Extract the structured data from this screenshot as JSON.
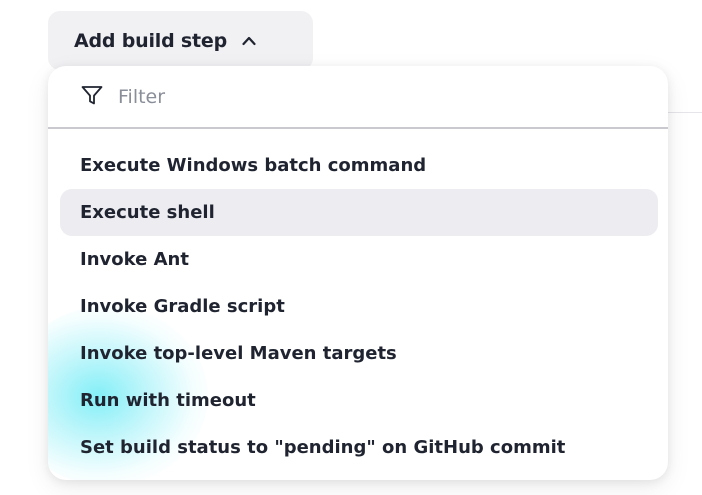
{
  "button": {
    "label": "Add build step",
    "icon": "chevron-up-icon"
  },
  "filter": {
    "icon": "filter-icon",
    "placeholder": "Filter",
    "value": ""
  },
  "menu": {
    "highlighted_index": 1,
    "items": [
      {
        "label": "Execute Windows batch command"
      },
      {
        "label": "Execute shell"
      },
      {
        "label": "Invoke Ant"
      },
      {
        "label": "Invoke Gradle script"
      },
      {
        "label": "Invoke top-level Maven targets"
      },
      {
        "label": "Run with timeout"
      },
      {
        "label": "Set build status to \"pending\" on GitHub commit"
      }
    ]
  },
  "colors": {
    "button_background": "#f1f1f4",
    "hover_background": "#ececf1",
    "text": "#1f2430",
    "placeholder": "#8a8e99",
    "divider": "#c9c9cf"
  }
}
